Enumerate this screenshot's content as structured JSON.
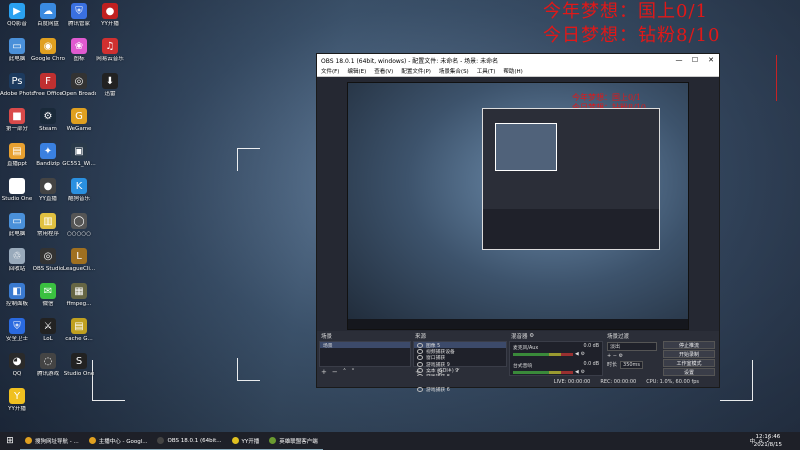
{
  "overlay": {
    "line1": "今年梦想：国上0/1",
    "line2": "今日梦想：钻粉8/10"
  },
  "desktop_icons": [
    {
      "label": "QQ影音",
      "color": "#2aa1f0",
      "glyph": "▶"
    },
    {
      "label": "此电脑",
      "color": "#4a90d9",
      "glyph": "▭"
    },
    {
      "label": "Adobe Photoshop",
      "color": "#1c3a5e",
      "glyph": "Ps"
    },
    {
      "label": "第一部分",
      "color": "#d94a4a",
      "glyph": "■"
    },
    {
      "label": "直播ppt",
      "color": "#e8a030",
      "glyph": "▤"
    },
    {
      "label": "Studio One",
      "color": "#ffffff",
      "glyph": "★"
    },
    {
      "label": "此电脑",
      "color": "#4a90d9",
      "glyph": "▭"
    },
    {
      "label": "回收站",
      "color": "#9ab",
      "glyph": "♲"
    },
    {
      "label": "控制面板",
      "color": "#3a7ad0",
      "glyph": "◧"
    },
    {
      "label": "安全卫士",
      "color": "#2a6adf",
      "glyph": "⛨"
    },
    {
      "label": "QQ",
      "color": "#2a2a2a",
      "glyph": "◕"
    },
    {
      "label": "YY开播",
      "color": "#f0c020",
      "glyph": "Y"
    },
    {
      "label": "百度网盘",
      "color": "#3a8ae0",
      "glyph": "☁"
    },
    {
      "label": "Google Chrome",
      "color": "#e0a020",
      "glyph": "◉"
    },
    {
      "label": "Free Office",
      "color": "#c03030",
      "glyph": "F"
    },
    {
      "label": "Steam",
      "color": "#1a2a3a",
      "glyph": "⚙"
    },
    {
      "label": "Bandizip",
      "color": "#3a80e0",
      "glyph": "✦"
    },
    {
      "label": "YY直播",
      "color": "#444",
      "glyph": "●"
    },
    {
      "label": "常用程序",
      "color": "#e0c040",
      "glyph": "▥"
    },
    {
      "label": "OBS Studio",
      "color": "#333",
      "glyph": "◎"
    },
    {
      "label": "微信",
      "color": "#3ac040",
      "glyph": "✉"
    },
    {
      "label": "LoL",
      "color": "#222",
      "glyph": "⚔"
    },
    {
      "label": "腾讯游戏",
      "color": "#444",
      "glyph": "◌"
    },
    {
      "label": "腾讯管家",
      "color": "#3a70e0",
      "glyph": "⛨"
    },
    {
      "label": "图标",
      "color": "#e05ad0",
      "glyph": "❀"
    },
    {
      "label": "Open Broadcast",
      "color": "#333",
      "glyph": "◎"
    },
    {
      "label": "WeGame",
      "color": "#e0a020",
      "glyph": "G"
    },
    {
      "label": "GC551_Wi...",
      "color": "#2a3a4a",
      "glyph": "▣"
    },
    {
      "label": "酷狗音乐",
      "color": "#2a90e0",
      "glyph": "K"
    },
    {
      "label": "○○○○○",
      "color": "#555",
      "glyph": "◯"
    },
    {
      "label": "LeagueCli...",
      "color": "#a07020",
      "glyph": "L"
    },
    {
      "label": "ffmpeg...",
      "color": "#664",
      "glyph": "▦"
    },
    {
      "label": "cache G...",
      "color": "#c0a020",
      "glyph": "▤"
    },
    {
      "label": "Studio One",
      "color": "#222",
      "glyph": "S"
    },
    {
      "label": "YY开播",
      "color": "#c02020",
      "glyph": "●"
    },
    {
      "label": "网易云音乐",
      "color": "#d03030",
      "glyph": "♫"
    },
    {
      "label": "迅雷",
      "color": "#222",
      "glyph": "⬇"
    }
  ],
  "obs": {
    "title": "OBS 18.0.1 (64bit, windows) - 配置文件: 未命名 - 场景: 未命名",
    "menu": [
      "文件(F)",
      "编辑(E)",
      "查看(V)",
      "配置文件(P)",
      "场景集合(S)",
      "工具(T)",
      "帮助(H)"
    ],
    "docks": {
      "scenes": {
        "title": "场景",
        "items": [
          "场景"
        ]
      },
      "sources": {
        "title": "来源",
        "items": [
          "图像 5",
          "视频捕获设备",
          "窗口捕获",
          "游戏捕获 9",
          "文本 (GDI+) 9",
          "游戏捕获 8",
          "游戏捕获 7",
          "游戏捕获 6"
        ]
      },
      "mixer": {
        "title": "混音器",
        "channels": [
          {
            "name": "麦克风/Aux",
            "db": "0.0 dB"
          },
          {
            "name": "台式音响",
            "db": "0.0 dB"
          }
        ]
      },
      "transitions": {
        "title": "场景过渡",
        "selected": "淡出",
        "duration_label": "时长",
        "duration": "350ms"
      },
      "controls": [
        "停止推流",
        "开始录制",
        "工作室模式",
        "设置",
        "退出"
      ]
    },
    "status": {
      "live": "LIVE: 00:00:00",
      "rec": "REC: 00:00:00",
      "cpu": "CPU: 1.0%, 60.00 fps"
    }
  },
  "taskbar": {
    "items": [
      {
        "label": "搜狗网址导航 - ...",
        "color": "#e0a020"
      },
      {
        "label": "主播中心 - Googl...",
        "color": "#e0a020"
      },
      {
        "label": "OBS 18.0.1 (64bit...",
        "color": "#444"
      },
      {
        "label": "YY开播",
        "color": "#e0c020"
      },
      {
        "label": "英雄联盟客户端",
        "color": "#6a9a30"
      }
    ],
    "time": "12:16:46",
    "date": "2021/8/15",
    "ime": "中"
  }
}
